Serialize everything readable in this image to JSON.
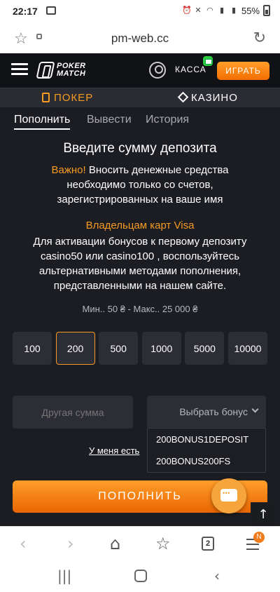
{
  "status": {
    "time": "22:17",
    "battery": "55%"
  },
  "browser": {
    "url": "pm-web.cc",
    "tab_count": "2",
    "menu_badge": "N"
  },
  "site": {
    "logo_line1": "POKER",
    "logo_line2": "MATCH",
    "cashier": "КАССА",
    "play": "ИГРАТЬ",
    "categories": {
      "poker": "ПОКЕР",
      "casino": "КАЗИНО"
    },
    "tabs": [
      "Пополнить",
      "Вывести",
      "История"
    ],
    "heading": "Введите сумму депозита",
    "notice_important": "Важно!",
    "notice_text": " Вносить денежные средства необходимо только со счетов, зарегистрированных на ваше имя",
    "visa_title": "Владельцам карт Visa",
    "visa_text": "Для активации бонусов к первому депозиту casino50 или casino100 , воспользуйтесь альтернативными методами пополнения, представленными на нашем сайте.",
    "limits": "Мин.. 50 ₴ - Макс.. 25 000 ₴",
    "amounts": [
      "100",
      "200",
      "500",
      "1000",
      "5000",
      "10000"
    ],
    "selected_amount": "200",
    "other_sum_placeholder": "Другая сумма",
    "bonus_select_label": "Выбрать бонус",
    "bonus_options": [
      "200BONUS1DEPOSIT",
      "200BONUS200FS"
    ],
    "promo_link": "У меня есть",
    "deposit_button": "ПОПОЛНИТЬ",
    "scroll_top_icon": "arrow-up-icon"
  }
}
